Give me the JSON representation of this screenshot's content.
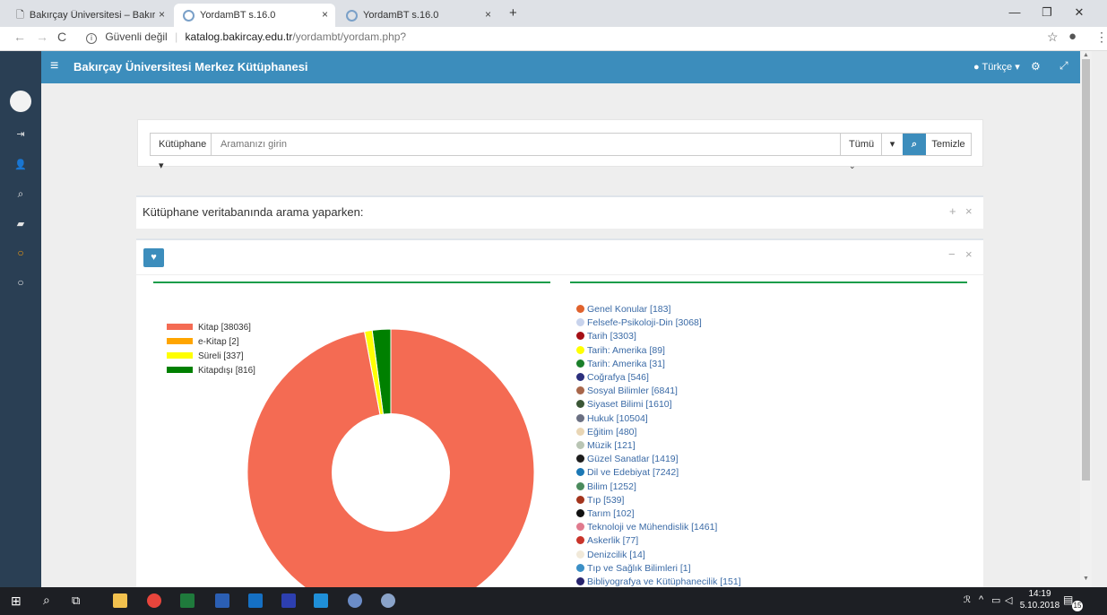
{
  "browser": {
    "tabs": [
      {
        "title": "Bakırçay Üniversitesi – Bakırçay Ü",
        "close": "×",
        "active": false
      },
      {
        "title": "YordamBT s.16.0",
        "close": "×",
        "active": true
      },
      {
        "title": "YordamBT s.16.0",
        "close": "×",
        "active": false
      }
    ],
    "new_tab": "+",
    "security": "Güvenli değil",
    "url_host": "katalog.bakircay.edu.tr",
    "url_path": "/yordambt/yordam.php?",
    "window_controls": {
      "minimize": "—",
      "maximize": "❐",
      "close": "✕"
    }
  },
  "app": {
    "title": "Bakırçay Üniversitesi Merkez Kütüphanesi",
    "language": "Türkçe",
    "search": {
      "scope_label": "Kütüphane",
      "placeholder": "Aramanızı girin",
      "type_label": "Tümü",
      "clear_label": "Temizle"
    },
    "info_title": "Kütüphane veritabanında arama yaparken:",
    "info_controls": {
      "expand": "+",
      "close": "×"
    },
    "chart_controls": {
      "collapse": "−",
      "close": "×"
    }
  },
  "chart_data": {
    "type": "pie",
    "series": [
      {
        "name": "Kitap [38036]",
        "value": 38036,
        "color": "#f46b53"
      },
      {
        "name": "e-Kitap [2]",
        "value": 2,
        "color": "#ffa500"
      },
      {
        "name": "Süreli [337]",
        "value": 337,
        "color": "#ffff00"
      },
      {
        "name": "Kitapdışı [816]",
        "value": 816,
        "color": "#008000"
      }
    ],
    "donut": true
  },
  "categories": [
    {
      "label": "Genel Konular [183]",
      "color": "#e0622d"
    },
    {
      "label": "Felsefe-Psikoloji-Din [3068]",
      "color": "#c8d3ec"
    },
    {
      "label": "Tarih [3303]",
      "color": "#a50f15"
    },
    {
      "label": "Tarih: Amerika [89]",
      "color": "#ffff00"
    },
    {
      "label": "Tarih: Amerika [31]",
      "color": "#1a7f2a"
    },
    {
      "label": "Coğrafya [546]",
      "color": "#2b2f7d"
    },
    {
      "label": "Sosyal Bilimler [6841]",
      "color": "#a8664a"
    },
    {
      "label": "Siyaset Bilimi [1610]",
      "color": "#3b5636"
    },
    {
      "label": "Hukuk [10504]",
      "color": "#6a6f82"
    },
    {
      "label": "Eğitim [480]",
      "color": "#e9d6b5"
    },
    {
      "label": "Müzik [121]",
      "color": "#b9c5b4"
    },
    {
      "label": "Güzel Sanatlar [1419]",
      "color": "#1c1c1c"
    },
    {
      "label": "Dil ve Edebiyat [7242]",
      "color": "#1c78b5"
    },
    {
      "label": "Bilim [1252]",
      "color": "#4a8a5c"
    },
    {
      "label": "Tıp [539]",
      "color": "#a3341c"
    },
    {
      "label": "Tarım [102]",
      "color": "#111111"
    },
    {
      "label": "Teknoloji ve Mühendislik [1461]",
      "color": "#e07a8e"
    },
    {
      "label": "Askerlik [77]",
      "color": "#c9342a"
    },
    {
      "label": "Denizcilik [14]",
      "color": "#f1e9d9"
    },
    {
      "label": "Tıp ve Sağlık Bilimleri [1]",
      "color": "#3b8fc6"
    },
    {
      "label": "Bibliyografya ve Kütüphanecilik [151]",
      "color": "#28246e"
    }
  ],
  "taskbar": {
    "time": "14:19",
    "date": "5.10.2018",
    "notifications": "15"
  }
}
